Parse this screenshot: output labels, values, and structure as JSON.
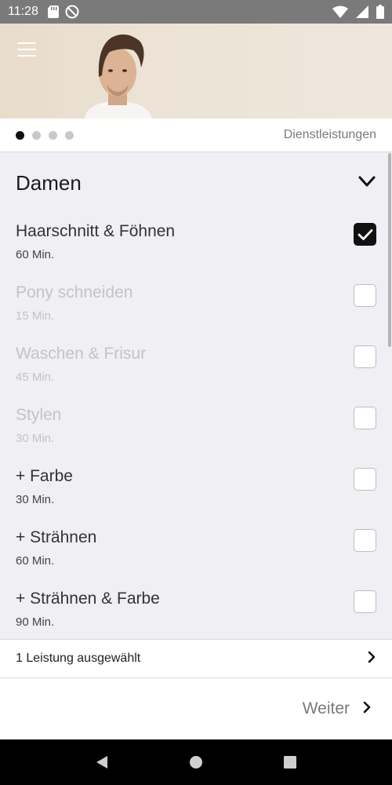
{
  "status_bar": {
    "time": "11:28",
    "left_icons": [
      "sd-card-icon",
      "do-not-disturb-icon"
    ],
    "right_icons": [
      "wifi-icon",
      "signal-icon",
      "battery-icon"
    ]
  },
  "pager": {
    "page_count": 4,
    "active_index": 0,
    "title": "Dienstleistungen"
  },
  "section": {
    "title": "Damen",
    "expanded": true
  },
  "services": [
    {
      "name": "Haarschnitt & Föhnen",
      "duration": "60 Min.",
      "checked": true,
      "enabled": true
    },
    {
      "name": "Pony schneiden",
      "duration": "15 Min.",
      "checked": false,
      "enabled": false
    },
    {
      "name": "Waschen & Frisur",
      "duration": "45 Min.",
      "checked": false,
      "enabled": false
    },
    {
      "name": "Stylen",
      "duration": "30 Min.",
      "checked": false,
      "enabled": false
    },
    {
      "name": "+ Farbe",
      "duration": "30 Min.",
      "checked": false,
      "enabled": true
    },
    {
      "name": "+ Strähnen",
      "duration": "60 Min.",
      "checked": false,
      "enabled": true
    },
    {
      "name": "+ Strähnen & Farbe",
      "duration": "90 Min.",
      "checked": false,
      "enabled": true
    }
  ],
  "summary": {
    "text": "1 Leistung ausgewählt"
  },
  "footer": {
    "next_label": "Weiter"
  },
  "colors": {
    "accent": "#111111",
    "background": "#f0eff3",
    "disabled_text": "#c4c4c8"
  }
}
